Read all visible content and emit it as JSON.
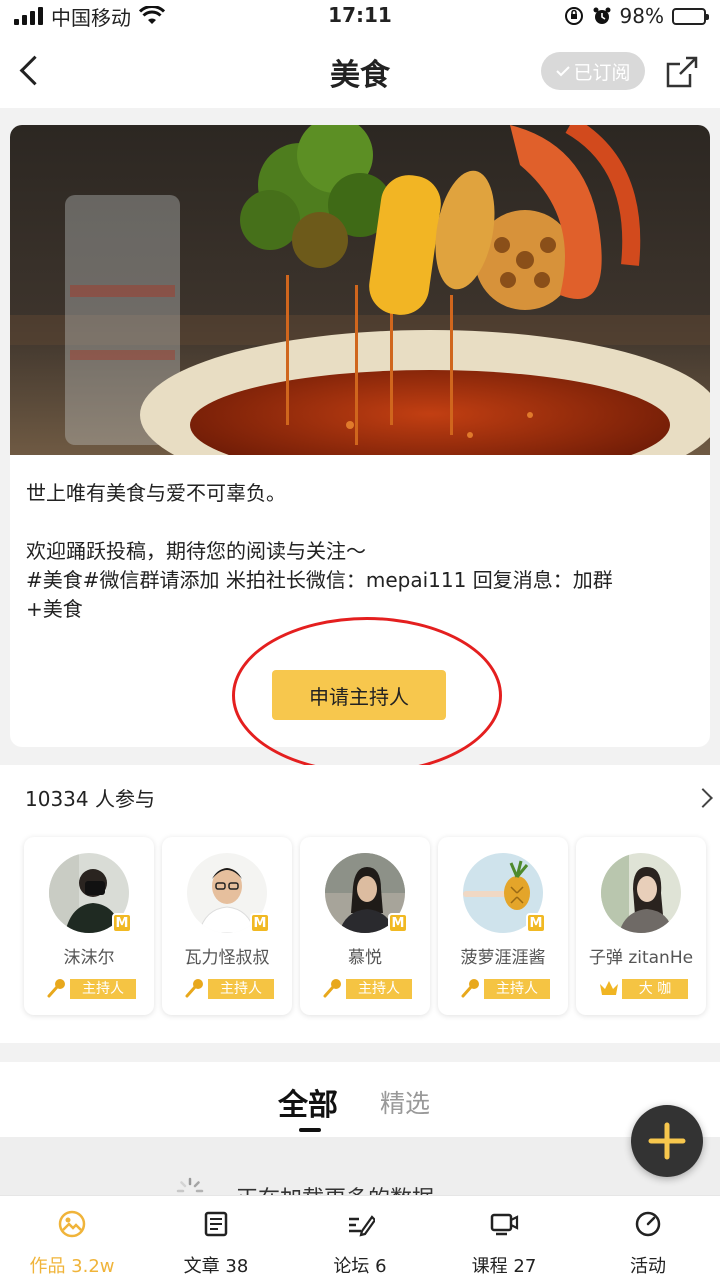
{
  "status_bar": {
    "carrier": "中国移动",
    "time": "17:11",
    "battery": "98%",
    "battery_level": 0.98
  },
  "header": {
    "title": "美食",
    "subscribed_label": "已订阅"
  },
  "intro": {
    "lines": [
      "世上唯有美食与爱不可辜负。",
      "",
      "欢迎踊跃投稿，期待您的阅读与关注～",
      "#美食#微信群请添加 米拍社长微信：mepai111 回复消息：加群",
      "+美食"
    ],
    "apply_button": "申请主持人"
  },
  "participants": {
    "count_label": "10334 人参与",
    "hosts": [
      {
        "name": "沫沫尔",
        "badge": "M",
        "role": "主持人",
        "role_icon": "microphone-icon"
      },
      {
        "name": "瓦力怪叔叔",
        "badge": "M",
        "role": "主持人",
        "role_icon": "microphone-icon"
      },
      {
        "name": "慕悦",
        "badge": "M",
        "role": "主持人",
        "role_icon": "microphone-icon"
      },
      {
        "name": "菠萝涯涯酱",
        "badge": "M",
        "role": "主持人",
        "role_icon": "microphone-icon"
      },
      {
        "name": "子弹 zitanHe",
        "badge": "",
        "role": "大 咖",
        "role_icon": "crown-icon"
      }
    ]
  },
  "feed_tabs": {
    "all": "全部",
    "featured": "精选",
    "loading_text": "正在加载更多的数据"
  },
  "bottom_nav": [
    {
      "label": "作品 3.2w",
      "icon": "photo-icon",
      "active": true
    },
    {
      "label": "文章 38",
      "icon": "article-icon",
      "active": false
    },
    {
      "label": "论坛 6",
      "icon": "forum-icon",
      "active": false
    },
    {
      "label": "课程 27",
      "icon": "course-icon",
      "active": false
    },
    {
      "label": "活动",
      "icon": "activity-icon",
      "active": false
    }
  ],
  "colors": {
    "accent": "#f7c74d",
    "role_tag": "#f5c443",
    "active_tab": "#f0b43a",
    "highlight_ring": "#e41f1f"
  }
}
